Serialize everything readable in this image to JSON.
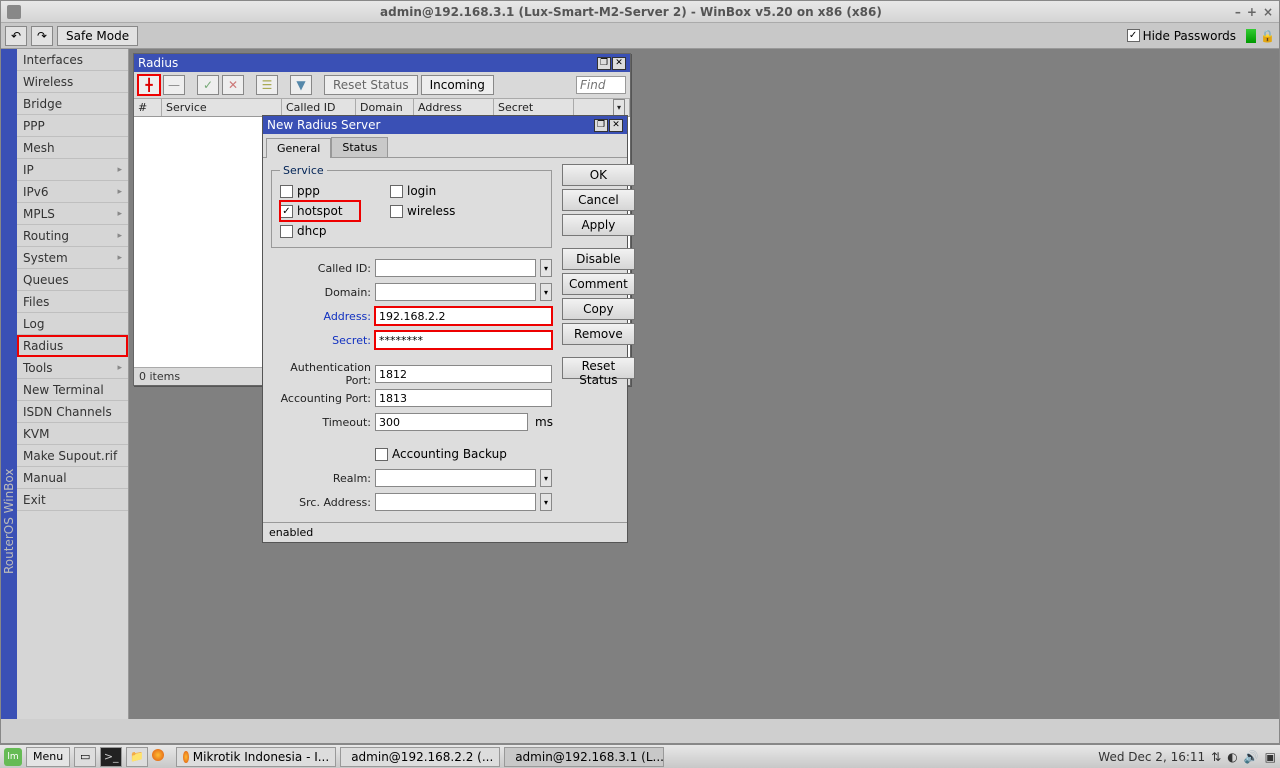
{
  "titlebar": {
    "title": "admin@192.168.3.1 (Lux-Smart-M2-Server 2) - WinBox v5.20 on x86 (x86)"
  },
  "toolbar": {
    "safemode": "Safe Mode",
    "hidepw": "Hide Passwords"
  },
  "sidemenu": {
    "items": [
      "Interfaces",
      "Wireless",
      "Bridge",
      "PPP",
      "Mesh",
      "IP",
      "IPv6",
      "MPLS",
      "Routing",
      "System",
      "Queues",
      "Files",
      "Log",
      "Radius",
      "Tools",
      "New Terminal",
      "ISDN Channels",
      "KVM",
      "Make Supout.rif",
      "Manual",
      "Exit"
    ],
    "submenu_idx": [
      5,
      6,
      7,
      8,
      9,
      14
    ],
    "highlight": "Radius",
    "vertlabel": "RouterOS WinBox"
  },
  "radiuswin": {
    "title": "Radius",
    "buttons": {
      "reset": "Reset Status",
      "incoming": "Incoming"
    },
    "find_placeholder": "Find",
    "cols": [
      "#",
      "Service",
      "Called ID",
      "Domain",
      "Address",
      "Secret"
    ],
    "status": "0 items"
  },
  "dialog": {
    "title": "New Radius Server",
    "tabs": {
      "general": "General",
      "status": "Status"
    },
    "service": {
      "legend": "Service",
      "ppp": "ppp",
      "login": "login",
      "hotspot": "hotspot",
      "wireless": "wireless",
      "dhcp": "dhcp",
      "hotspot_checked": true
    },
    "labels": {
      "called_id": "Called ID:",
      "domain": "Domain:",
      "address": "Address:",
      "secret": "Secret:",
      "auth_port": "Authentication Port:",
      "acct_port": "Accounting Port:",
      "timeout": "Timeout:",
      "timeout_unit": "ms",
      "acct_backup": "Accounting Backup",
      "realm": "Realm:",
      "src_addr": "Src. Address:"
    },
    "values": {
      "address": "192.168.2.2",
      "secret": "********",
      "auth_port": "1812",
      "acct_port": "1813",
      "timeout": "300"
    },
    "buttons": {
      "ok": "OK",
      "cancel": "Cancel",
      "apply": "Apply",
      "disable": "Disable",
      "comment": "Comment",
      "copy": "Copy",
      "remove": "Remove",
      "reset": "Reset Status"
    },
    "status": "enabled"
  },
  "taskbar": {
    "menu": "Menu",
    "tasks": [
      "Mikrotik Indonesia - I...",
      "admin@192.168.2.2 (...",
      "admin@192.168.3.1 (L..."
    ],
    "clock": "Wed Dec  2, 16:11"
  }
}
